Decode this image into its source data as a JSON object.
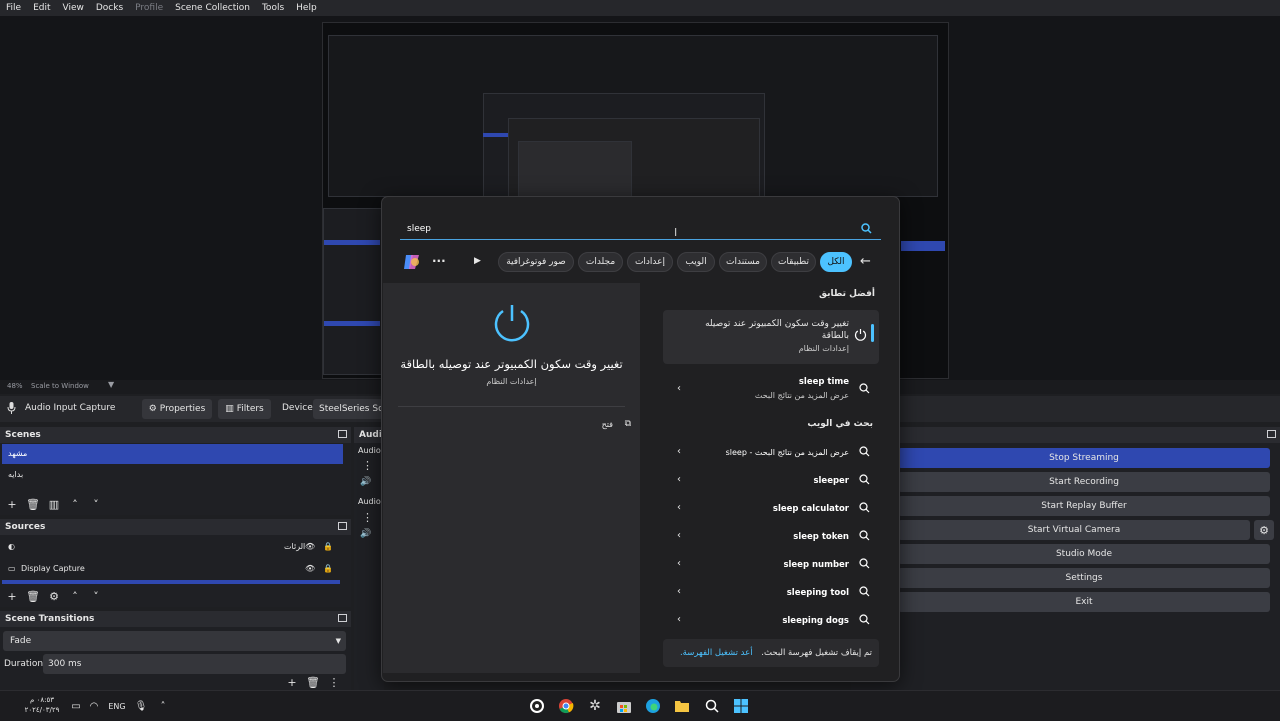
{
  "menubar": {
    "items": [
      "File",
      "Edit",
      "View",
      "Docks",
      "Profile",
      "Scene Collection",
      "Tools",
      "Help"
    ]
  },
  "preview": {
    "zoom": "48%",
    "scale_mode": "Scale to Window"
  },
  "source_toolbar": {
    "source_name": "Audio Input Capture",
    "properties_label": "Properties",
    "filters_label": "Filters",
    "device_label": "Device",
    "device_value": "SteelSeries Sona"
  },
  "scenes": {
    "title": "Scenes",
    "items": [
      "مشهد",
      "بدايه"
    ]
  },
  "sources": {
    "title": "Sources",
    "items": [
      "الرئات",
      "Display Capture"
    ]
  },
  "transitions": {
    "title": "Scene Transitions",
    "value": "Fade",
    "duration_label": "Duration",
    "duration_value": "300 ms"
  },
  "audio": {
    "title": "Audio",
    "row1": "Audio",
    "row2": "Audio"
  },
  "controls": {
    "buttons": [
      "Stop Streaming",
      "Start Recording",
      "Start Replay Buffer",
      "Start Virtual Camera",
      "Studio Mode",
      "Settings",
      "Exit"
    ]
  },
  "search": {
    "query": "sleep",
    "tabs": [
      "الكل",
      "تطبيقات",
      "مستندات",
      "الويب",
      "إعدادات",
      "مجلدات",
      "صور فوتوغرافية"
    ],
    "best_match_heading": "أفضل تطابق",
    "best_match_title": "تغيير وقت سكون الكمبيوتر عند توصيله بالطاقة",
    "best_match_sub": "إعدادات النظام",
    "sleep_time_title": "sleep time",
    "sleep_time_sub": "عرض المزيد من نتائج البحث",
    "web_heading": "بحث في الويب",
    "web_results": [
      "sleep - عرض المزيد من نتائج البحث",
      "sleeper",
      "sleep calculator",
      "sleep token",
      "sleep number",
      "sleeping tool",
      "sleeping dogs"
    ],
    "preview_title": "تغيير وقت سكون الكمبيوتر عند توصيله بالطاقة",
    "preview_sub": "إعدادات النظام",
    "open_label": "فتح",
    "footer_text": "تم إيقاف تشغيل فهرسة البحث.",
    "footer_link": "أعد تشغيل الفهرسة."
  },
  "taskbar": {
    "time": "٠٨:٥٣ م",
    "date": "٢٠٢٤/٠٣/٢٩",
    "lang": "ENG"
  },
  "colors": {
    "accent": "#4cc2ff",
    "obs_select": "#2f48b0"
  }
}
